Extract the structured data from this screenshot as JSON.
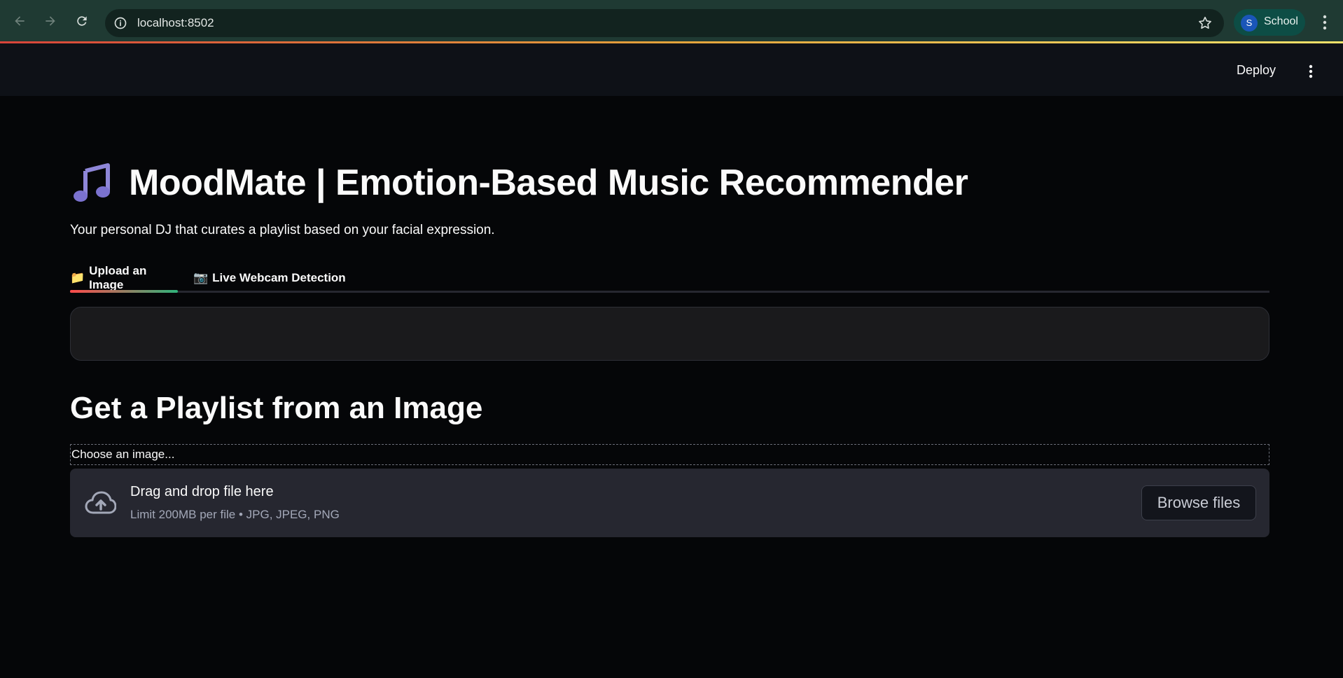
{
  "browser": {
    "url": "localhost:8502",
    "profile_initial": "S",
    "profile_name": "School"
  },
  "header": {
    "deploy_label": "Deploy"
  },
  "main": {
    "title_icon": "music-note-icon",
    "title": "MoodMate | Emotion-Based Music Recommender",
    "subtitle": "Your personal DJ that curates a playlist based on your facial expression.",
    "tabs": [
      {
        "icon": "📁",
        "label": "Upload an Image",
        "active": true
      },
      {
        "icon": "📷",
        "label": "Live Webcam Detection",
        "active": false
      }
    ],
    "section_heading": "Get a Playlist from an Image",
    "uploader": {
      "label": "Choose an image...",
      "drop_text": "Drag and drop file here",
      "limit_text": "Limit 200MB per file • JPG, JPEG, PNG",
      "browse_label": "Browse files"
    }
  },
  "colors": {
    "background": "#050608",
    "header_bg": "#0e1117",
    "browser_bar": "#1f3a33",
    "accent_red": "#ff4b4b",
    "dropzone_bg": "#262730"
  }
}
